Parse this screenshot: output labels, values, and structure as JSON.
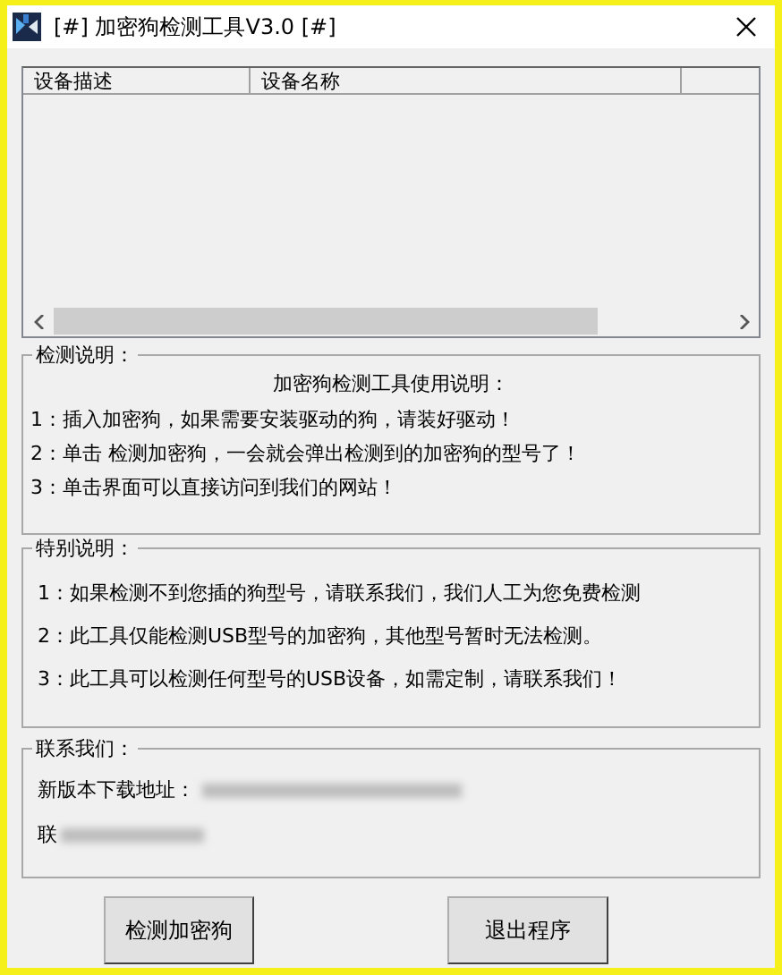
{
  "window": {
    "title": "[#] 加密狗检测工具V3.0 [#]"
  },
  "device_list": {
    "columns": [
      "设备描述",
      "设备名称"
    ]
  },
  "detection_notes": {
    "title": "检测说明：",
    "heading": "加密狗检测工具使用说明：",
    "lines": [
      "1：插入加密狗，如果需要安装驱动的狗，请装好驱动！",
      "2：单击 检测加密狗，一会就会弹出检测到的加密狗的型号了！",
      "3：单击界面可以直接访问到我们的网站！"
    ]
  },
  "special_notes": {
    "title": "特别说明：",
    "lines": [
      "1：如果检测不到您插的狗型号，请联系我们，我们人工为您免费检测",
      "2：此工具仅能检测USB型号的加密狗，其他型号暂时无法检测。",
      "3：此工具可以检测任何型号的USB设备，如需定制，请联系我们！"
    ]
  },
  "contact": {
    "title": "联系我们：",
    "lines": [
      {
        "label": "新版本下载地址：",
        "redacted": true
      },
      {
        "label": "联",
        "redacted": true
      }
    ]
  },
  "buttons": [
    "检测加密狗",
    "退出程序"
  ]
}
